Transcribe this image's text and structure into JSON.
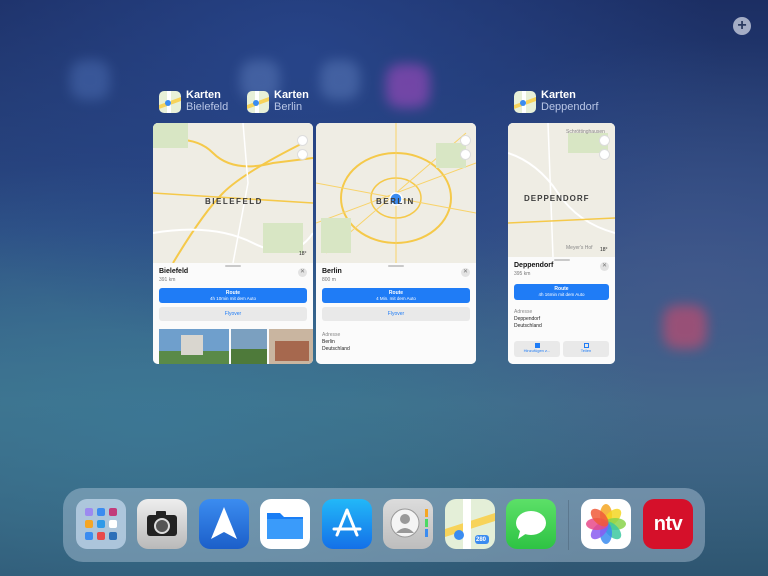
{
  "switcher": {
    "cards": [
      {
        "app": "Karten",
        "subtitle": "Bielefeld",
        "city_label": "BIELEFELD",
        "place": "Bielefeld",
        "distance": "391 km",
        "route_label": "Route",
        "route_time": "4h 10min mit dem Auto",
        "flyover_label": "Flyover",
        "temperature": "18°"
      },
      {
        "app": "Karten",
        "subtitle": "Berlin",
        "city_label": "BERLIN",
        "place": "Berlin",
        "distance": "800 m",
        "route_label": "Route",
        "route_time": "4 Min. mit dem Auto",
        "flyover_label": "Flyover",
        "address_label": "Adresse",
        "address_lines": [
          "Berlin",
          "Deutschland"
        ]
      },
      {
        "app": "Karten",
        "subtitle": "Deppendorf",
        "city_label": "DEPPENDORF",
        "place": "Deppendorf",
        "distance": "395 km",
        "route_label": "Route",
        "route_time": "4h 16min mit dem Auto",
        "address_label": "Adresse",
        "address_lines": [
          "Deppendorf",
          "Deutschland"
        ],
        "map_labels": [
          "Schröttinghausen",
          "Meyer's Hof"
        ],
        "temperature": "18°",
        "action_add": "Hinzufügen z...",
        "action_share": "Teilen"
      }
    ]
  },
  "dock": {
    "apps": [
      {
        "name": "folder"
      },
      {
        "name": "camera"
      },
      {
        "name": "spark"
      },
      {
        "name": "files"
      },
      {
        "name": "app-store"
      },
      {
        "name": "contacts"
      },
      {
        "name": "maps",
        "badge": "280"
      },
      {
        "name": "messages"
      },
      {
        "name": "photos"
      },
      {
        "name": "ntv",
        "label": "ntv"
      }
    ]
  },
  "colors": {
    "accent": "#1f7cf6",
    "ntv_red": "#d5102a",
    "messages_green": "#3ccf4e"
  }
}
